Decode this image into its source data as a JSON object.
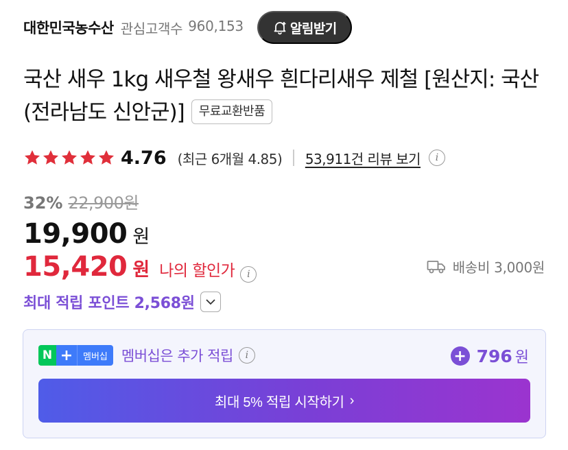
{
  "store": {
    "name": "대한민국농수산",
    "interest_label": "관심고객수",
    "interest_count": "960,153",
    "alarm_label": "알림받기"
  },
  "product": {
    "title": "국산 새우 1kg 새우철 왕새우 흰다리새우 제철 [원산지: 국산(전라남도 신안군)]",
    "badge": "무료교환반품"
  },
  "rating": {
    "stars": 5,
    "value": "4.76",
    "recent": "(최근 6개월 4.85)",
    "reviews_link": "53,911건 리뷰 보기",
    "star_color": "#e02f3a"
  },
  "price": {
    "discount_pct": "32%",
    "original": "22,900원",
    "current": "19,900",
    "current_unit": "원",
    "my_price": "15,420",
    "my_price_unit": "원",
    "my_price_label": "나의 할인가",
    "shipping": "배송비 3,000원",
    "max_points": "최대 적립 포인트 2,568원"
  },
  "membership": {
    "n_logo": "N",
    "plus_logo": "+",
    "membership_logo": "멤버십",
    "text": "멤버십은 추가 적립",
    "extra_points": "796",
    "extra_points_unit": "원",
    "cta": "최대 5% 적립 시작하기",
    "cta_arrow": "›"
  },
  "colors": {
    "accent_purple": "#7b4fd6",
    "price_red": "#e0283c",
    "naver_green": "#03c75a"
  }
}
